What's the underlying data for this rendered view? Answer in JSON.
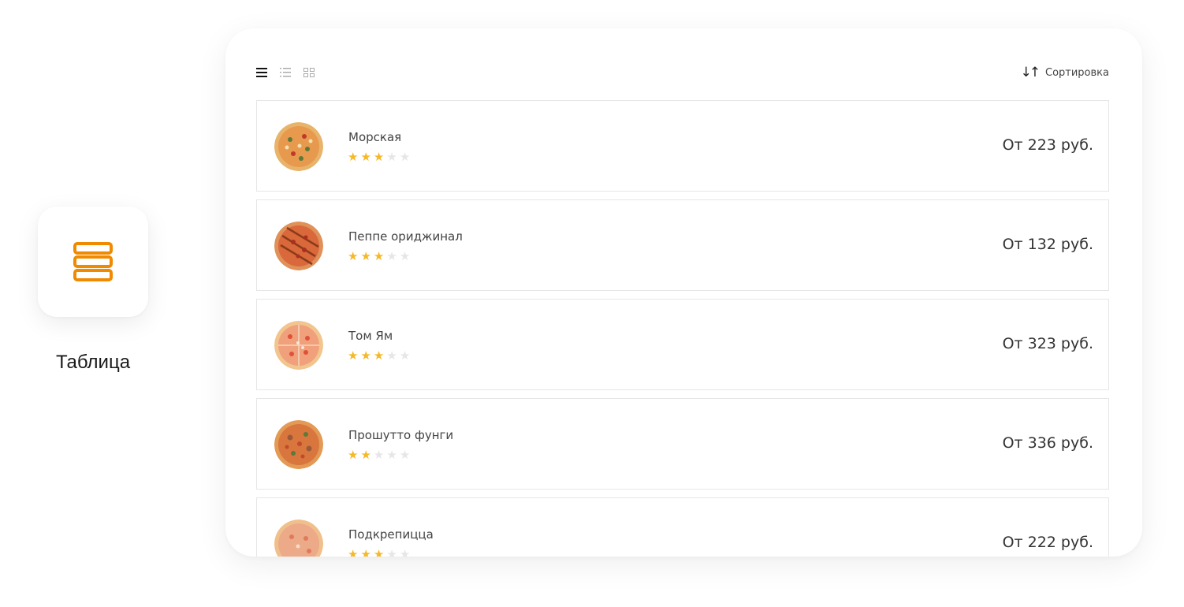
{
  "feature": {
    "label": "Таблица",
    "icon": "table-rows-icon",
    "accent_color": "#f08a00"
  },
  "toolbar": {
    "view_modes": [
      {
        "name": "table-view",
        "icon": "menu-lines-icon",
        "active": true
      },
      {
        "name": "list-view",
        "icon": "list-bullets-icon",
        "active": false
      },
      {
        "name": "grid-view",
        "icon": "grid-icon",
        "active": false
      }
    ],
    "sort_icon": "↓↑",
    "sort_label": "Сортировка"
  },
  "products": [
    {
      "name": "Морская",
      "rating": 3,
      "price_prefix": "От",
      "price": "223 руб.",
      "pizza_color": "#e79a4d"
    },
    {
      "name": "Пеппе ориджинал",
      "rating": 3,
      "price_prefix": "От",
      "price": "132 руб.",
      "pizza_color": "#d9683a"
    },
    {
      "name": "Том Ям",
      "rating": 3,
      "price_prefix": "От",
      "price": "323 руб.",
      "pizza_color": "#f0a07a"
    },
    {
      "name": "Прошутто фунги",
      "rating": 2,
      "price_prefix": "От",
      "price": "336 руб.",
      "pizza_color": "#d8763e"
    },
    {
      "name": "Подкрепицца",
      "rating": 3,
      "price_prefix": "От",
      "price": "222 руб.",
      "pizza_color": "#ecaa88"
    }
  ],
  "colors": {
    "star_on": "#f5b827",
    "star_off": "#e6e6e6"
  }
}
